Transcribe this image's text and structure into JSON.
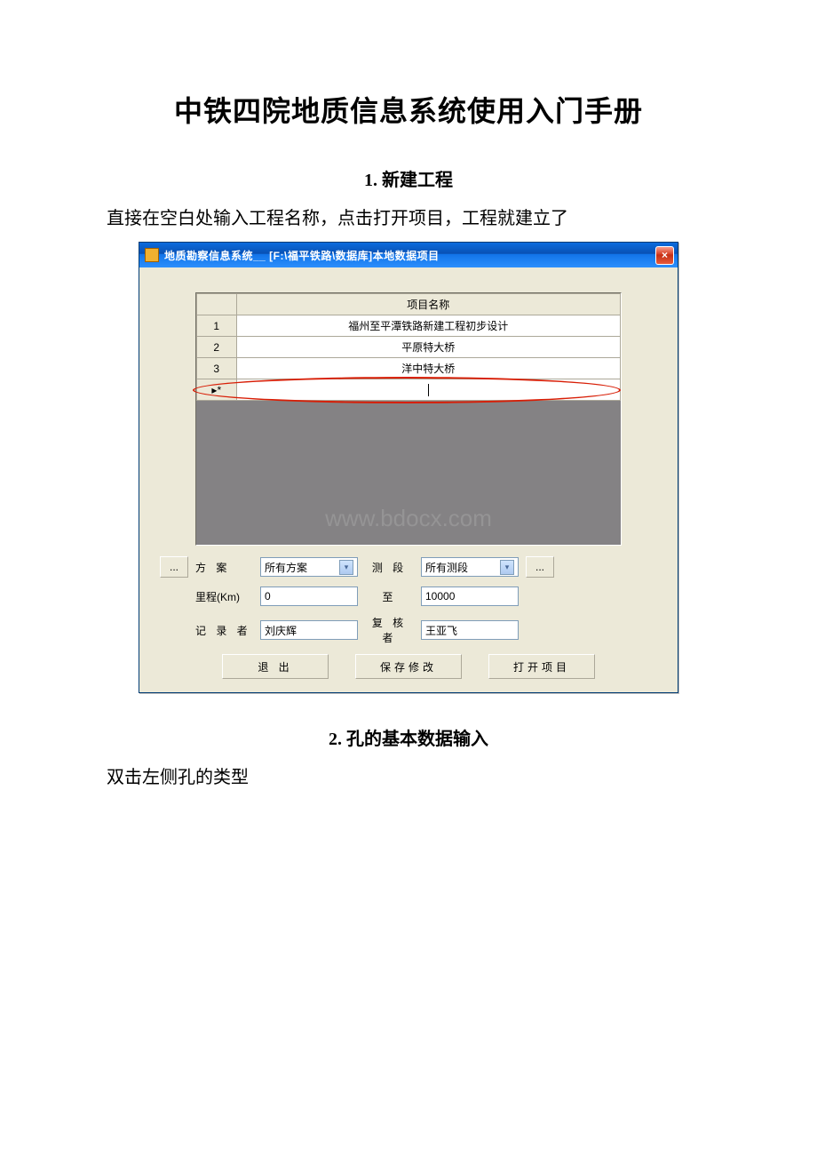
{
  "doc": {
    "title": "中铁四院地质信息系统使用入门手册",
    "section1_title": "1. 新建工程",
    "para1": "直接在空白处输入工程名称，点击打开项目，工程就建立了",
    "section2_title": "2. 孔的基本数据输入",
    "para2": "双击左侧孔的类型"
  },
  "window": {
    "title": "地质勘察信息系统__ [F:\\福平铁路\\数据库]本地数据项目",
    "close_glyph": "×"
  },
  "grid": {
    "header_name": "项目名称",
    "rows": [
      {
        "n": "1",
        "name": "福州至平潭铁路新建工程初步设计"
      },
      {
        "n": "2",
        "name": "平原特大桥"
      },
      {
        "n": "3",
        "name": "洋中特大桥"
      }
    ],
    "new_row_marker": "▸*"
  },
  "watermark": "www.bdocx.com",
  "controls": {
    "ellipsis": "...",
    "scheme_label": "方  案",
    "scheme_value": "所有方案",
    "section_label": "测  段",
    "section_value": "所有测段",
    "mileage_label": "里程(Km)",
    "mileage_from": "0",
    "to_label": "至",
    "mileage_to": "10000",
    "recorder_label": "记 录 者",
    "recorder_value": "刘庆辉",
    "reviewer_label": "复 核 者",
    "reviewer_value": "王亚飞",
    "btn_exit": "退  出",
    "btn_save": "保存修改",
    "btn_open": "打开项目"
  }
}
